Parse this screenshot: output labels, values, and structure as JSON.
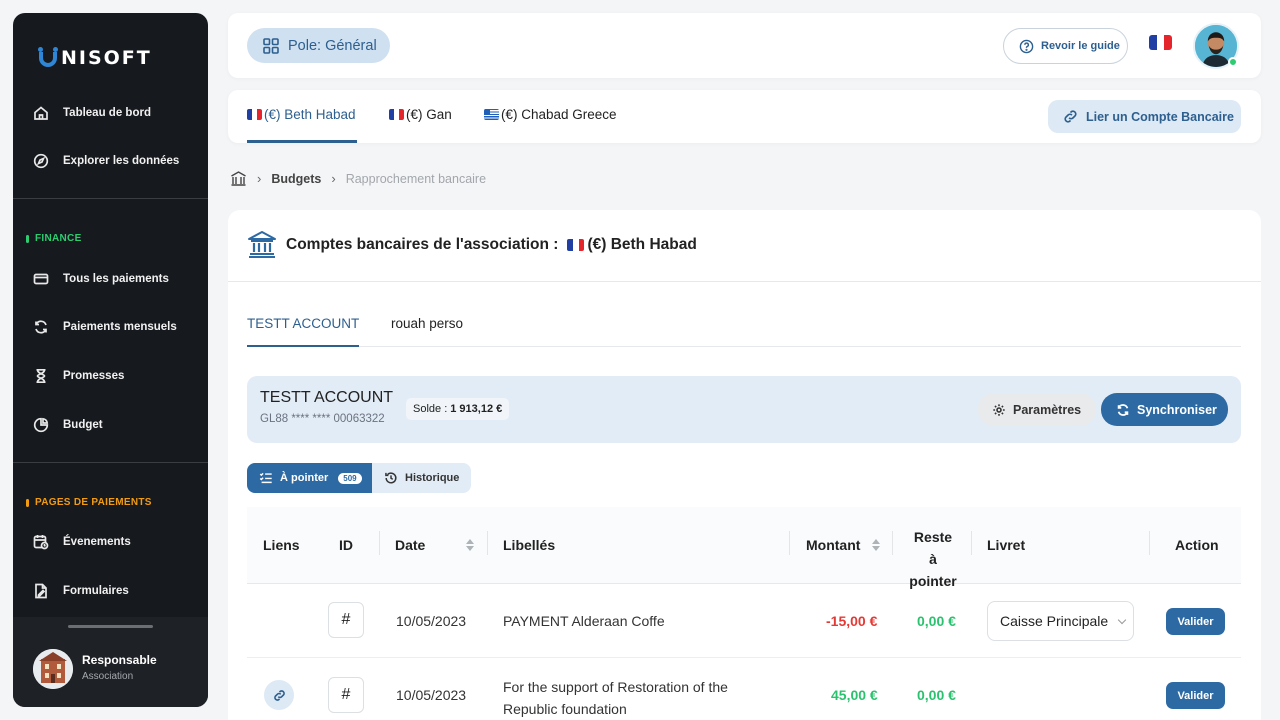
{
  "app": {
    "logo_text": "NISOFT"
  },
  "sidebar": {
    "items": [
      {
        "label": "Tableau de bord",
        "icon": "home-icon"
      },
      {
        "label": "Explorer les données",
        "icon": "compass-icon"
      }
    ],
    "finance_section": "FINANCE",
    "finance_items": [
      {
        "label": "Tous les paiements",
        "icon": "credit-card-icon"
      },
      {
        "label": "Paiements mensuels",
        "icon": "refresh-icon"
      },
      {
        "label": "Promesses",
        "icon": "hourglass-icon"
      },
      {
        "label": "Budget",
        "icon": "pie-chart-icon"
      }
    ],
    "pages_section": "PAGES DE PAIEMENTS",
    "pages_items": [
      {
        "label": "Évenements",
        "icon": "calendar-clock-icon"
      },
      {
        "label": "Formulaires",
        "icon": "form-icon"
      }
    ],
    "user": {
      "name": "Responsable",
      "role": "Association"
    },
    "colors": {
      "finance": "#2ecc71",
      "pages": "#f39c12"
    }
  },
  "topbar": {
    "pole_label": "Pole: Général",
    "guide_label": "Revoir le guide"
  },
  "accounts_bar": {
    "tabs": [
      {
        "label": "(€) Beth Habad",
        "flag": "fr",
        "active": true
      },
      {
        "label": "(€) Gan",
        "flag": "fr",
        "active": false
      },
      {
        "label": "(€) Chabad Greece",
        "flag": "gr",
        "active": false
      }
    ],
    "link_label": "Lier un Compte Bancaire"
  },
  "breadcrumb": {
    "items": [
      "Budgets",
      "Rapprochement bancaire"
    ]
  },
  "card": {
    "title_prefix": "Comptes bancaires de l'association :",
    "title_account": "(€) Beth Habad",
    "sub_tabs": [
      "TESTT ACCOUNT",
      "rouah perso"
    ],
    "account": {
      "name": "TESTT ACCOUNT",
      "iban": "GL88 **** **** 00063322",
      "solde_label": "Solde :",
      "solde_value": "1 913,12 €"
    },
    "params_label": "Paramètres",
    "sync_label": "Synchroniser",
    "segment": {
      "a_label": "À pointer",
      "a_count": "509",
      "b_label": "Historique"
    }
  },
  "table": {
    "headers": {
      "liens": "Liens",
      "id": "ID",
      "date": "Date",
      "libelles": "Libellés",
      "montant": "Montant",
      "reste1": "Reste à",
      "reste2": "pointer",
      "livret": "Livret",
      "action": "Action"
    },
    "rows": [
      {
        "id": "#",
        "date": "10/05/2023",
        "label": "PAYMENT Alderaan Coffe",
        "label2": "",
        "amount": "-15,00 €",
        "remaining": "0,00 €",
        "livret": "Caisse Principale",
        "action": "Valider",
        "has_link": false
      },
      {
        "id": "#",
        "date": "10/05/2023",
        "label": "For the support of Restoration of the",
        "label2": "Republic foundation",
        "amount": "45,00 €",
        "remaining": "0,00 €",
        "livret": "",
        "action": "Valider",
        "has_link": true
      }
    ]
  }
}
